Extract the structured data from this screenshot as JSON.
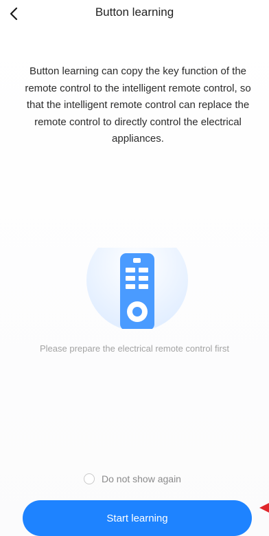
{
  "header": {
    "title": "Button learning",
    "back_icon": "chevron-left-icon"
  },
  "content": {
    "description": "Button learning can copy the key function of the remote control to the intelligent remote control, so that the intelligent remote control can replace the remote control to directly control the electrical appliances.",
    "illustration_icon": "remote-control-icon",
    "hint": "Please prepare the electrical remote control first"
  },
  "footer": {
    "do_not_show_label": "Do not show again",
    "do_not_show_checked": false,
    "start_button_label": "Start learning"
  },
  "colors": {
    "accent": "#1e83ff",
    "remote": "#4a9bff",
    "annotation_arrow": "#e0262b"
  }
}
